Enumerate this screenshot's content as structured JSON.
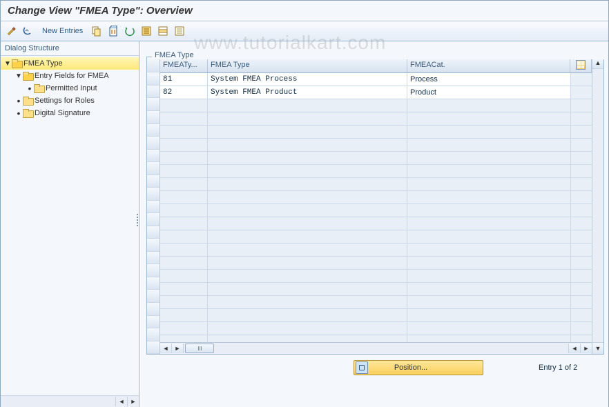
{
  "title": "Change View \"FMEA Type\": Overview",
  "watermark": "www.tutorialkart.com",
  "toolbar": {
    "new_entries_label": "New Entries"
  },
  "tree": {
    "header": "Dialog Structure",
    "items": [
      {
        "label": "FMEA Type",
        "level": 0,
        "expandable": true,
        "expanded": true,
        "selected": true,
        "folder": "open"
      },
      {
        "label": "Entry Fields for FMEA",
        "level": 1,
        "expandable": true,
        "expanded": true,
        "selected": false,
        "folder": "open"
      },
      {
        "label": "Permitted Input",
        "level": 2,
        "expandable": false,
        "expanded": false,
        "selected": false,
        "folder": "closed",
        "leaf": true
      },
      {
        "label": "Settings for Roles",
        "level": 1,
        "expandable": false,
        "expanded": false,
        "selected": false,
        "folder": "closed",
        "leaf": true
      },
      {
        "label": "Digital Signature",
        "level": 1,
        "expandable": false,
        "expanded": false,
        "selected": false,
        "folder": "closed",
        "leaf": true
      }
    ]
  },
  "grid": {
    "title": "FMEA Type",
    "columns": {
      "a": "FMEATy...",
      "b": "FMEA Type",
      "c": "FMEACat."
    },
    "rows": [
      {
        "a": "81",
        "b": "System FMEA Process",
        "c": "Process"
      },
      {
        "a": "82",
        "b": "System FMEA Product",
        "c": "Product"
      }
    ],
    "empty_row_count": 20
  },
  "footer": {
    "position_label": "Position...",
    "entry_text": "Entry 1 of 2"
  }
}
